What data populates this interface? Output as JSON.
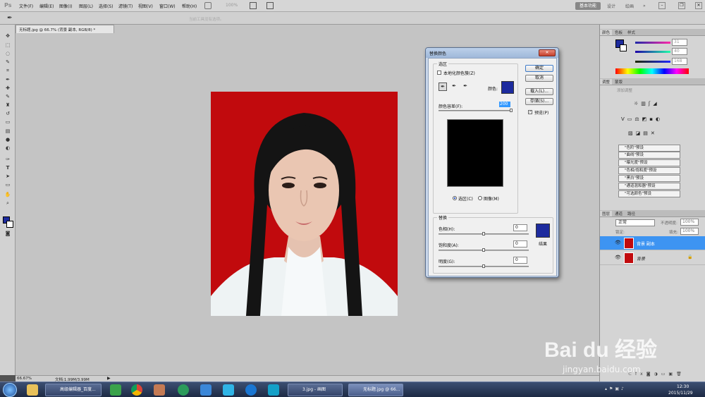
{
  "app": {
    "logo": "Ps"
  },
  "menu": [
    "文件(F)",
    "编辑(E)",
    "图像(I)",
    "图层(L)",
    "选择(S)",
    "滤镜(T)",
    "视图(V)",
    "窗口(W)",
    "帮助(H)"
  ],
  "menubar_right": {
    "zoom": "100%",
    "workspace": "基本功能",
    "design": "设计",
    "painting": "绘画"
  },
  "options_bar": {
    "hint": "当前工具没有选项。"
  },
  "document": {
    "tab_title": "无标题.jpg @ 66.7% (背景 副本, RGB/8) *",
    "zoom": "66.67%",
    "doc_info": "文档:1.99M/3.99M"
  },
  "dialog": {
    "title": "替换颜色",
    "selection_group": "选区",
    "localized_label": "本地化颜色簇(Z)",
    "color_label": "颜色:",
    "fuzziness_label": "颜色容差(F):",
    "fuzziness_value": "200",
    "radio_selection": "选区(C)",
    "radio_image": "图像(M)",
    "replace_group": "替换",
    "hue_label": "色相(H):",
    "hue_value": "0",
    "saturation_label": "饱和度(A):",
    "saturation_value": "0",
    "lightness_label": "明度(G):",
    "lightness_value": "0",
    "result_label": "结果",
    "ok": "确定",
    "cancel": "取消",
    "load": "载入(L)...",
    "save": "存储(S)...",
    "preview": "预览(P)",
    "swatch_color": "#1d2b9e"
  },
  "color_panel": {
    "tabs": [
      "颜色",
      "色板",
      "样式"
    ],
    "r": "31",
    "g": "40",
    "b": "168"
  },
  "adjust_panel": {
    "tabs": [
      "调整",
      "蒙版"
    ],
    "add_adjustment": "添加调整",
    "presets": [
      "\"色阶\"预设",
      "\"曲线\"预设",
      "\"曝光度\"预设",
      "\"色相/饱和度\"预设",
      "\"黑白\"预设",
      "\"通道混和器\"预设",
      "\"可选颜色\"预设"
    ]
  },
  "layers_panel": {
    "tabs": [
      "图层",
      "通道",
      "路径"
    ],
    "blend_mode": "正常",
    "opacity_label": "不透明度:",
    "opacity": "100%",
    "lock_label": "锁定:",
    "fill_label": "填充:",
    "fill": "100%",
    "layers": [
      {
        "name": "背景 副本",
        "selected": true
      },
      {
        "name": "背景",
        "selected": false
      }
    ]
  },
  "taskbar": {
    "apps": [
      "高级编辑器_百度...",
      "3.jpg - 画图",
      "无标题.jpg @ 66..."
    ],
    "time": "12:30",
    "date": "2015/11/29"
  },
  "watermark": {
    "brand": "Bai du 经验",
    "url": "jingyan.baidu.com"
  }
}
